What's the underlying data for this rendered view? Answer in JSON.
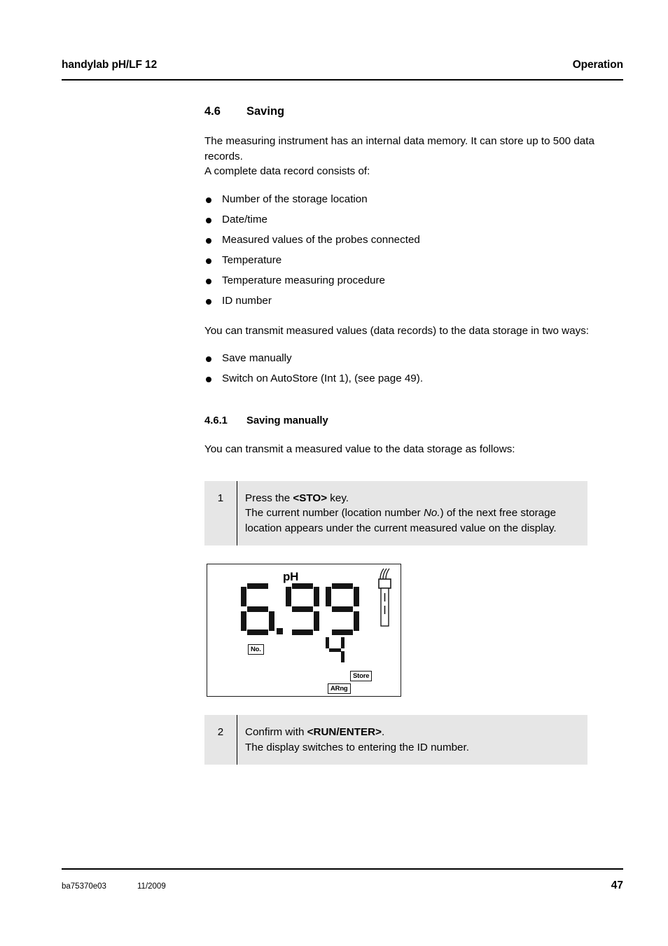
{
  "header": {
    "left": "handylab pH/LF 12",
    "right": "Operation"
  },
  "section": {
    "number": "4.6",
    "title": "Saving",
    "intro_paragraph": "The measuring instrument has an internal data memory. It can store up to 500 data records.\nA complete data record consists of:",
    "record_items": [
      "Number of the storage location",
      "Date/time",
      "Measured values of the probes connected",
      "Temperature",
      "Temperature measuring procedure",
      "ID number"
    ],
    "transmit_paragraph": "You can transmit measured values (data records) to the data storage in two ways:",
    "transmit_items": [
      "Save manually",
      "Switch on AutoStore (Int 1), (see page 49)."
    ]
  },
  "subsection": {
    "number": "4.6.1",
    "title": "Saving manually",
    "intro_paragraph": "You can transmit a measured value to the data storage as follows:"
  },
  "steps": [
    {
      "number": "1",
      "line1_pre": "Press the ",
      "line1_key": "<STO>",
      "line1_post": " key.",
      "line2_pre": "The current number (location number ",
      "line2_italic": "No.",
      "line2_post": ") of the next free storage location appears under the current measured value on the display."
    },
    {
      "number": "2",
      "line1_pre": "Confirm with ",
      "line1_key": "<RUN/ENTER>",
      "line1_post": ".",
      "line2": "The display switches to entering the ID number."
    }
  ],
  "lcd": {
    "unit": "pH",
    "value_digits": [
      "6",
      "9",
      "9"
    ],
    "value_text": "6.99",
    "decimal_after_index": 0,
    "location_digit": "4",
    "badges": {
      "no": "No.",
      "store": "Store",
      "arng": "ARng"
    },
    "probe_icon": "ph-electrode-icon"
  },
  "footer": {
    "doc_id": "ba75370e03",
    "doc_date": "11/2009",
    "page_number": "47"
  },
  "colors": {
    "text": "#000000",
    "step_box_bg": "#e6e6e6",
    "lcd_border": "#1a1a1a",
    "segment": "#151515"
  },
  "segment_map": {
    "4": [
      "sb",
      "sc",
      "sf",
      "sg"
    ],
    "6": [
      "sa",
      "sc",
      "sd",
      "se",
      "sf",
      "sg"
    ],
    "9": [
      "sa",
      "sb",
      "sc",
      "sd",
      "sf",
      "sg"
    ]
  }
}
